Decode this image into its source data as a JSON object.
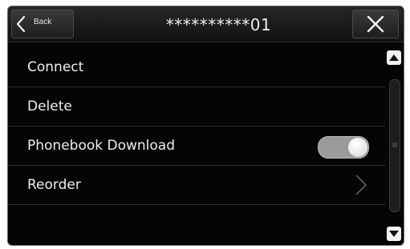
{
  "header": {
    "back_label": "Back",
    "title": "**********01"
  },
  "list": {
    "items": [
      {
        "label": "Connect"
      },
      {
        "label": "Delete"
      },
      {
        "label": "Phonebook Download",
        "control": "toggle",
        "toggle_on": true
      },
      {
        "label": "Reorder",
        "control": "chevron-right-icon"
      }
    ]
  },
  "colors": {
    "background": "#050505",
    "text": "#eeeeee",
    "toggle_track": "#9a9a9a",
    "divider": "#2e2e2e"
  },
  "icons": {
    "back": "chevron-left-icon",
    "close": "close-icon",
    "scroll_up": "triangle-up-icon",
    "scroll_down": "triangle-down-icon"
  }
}
